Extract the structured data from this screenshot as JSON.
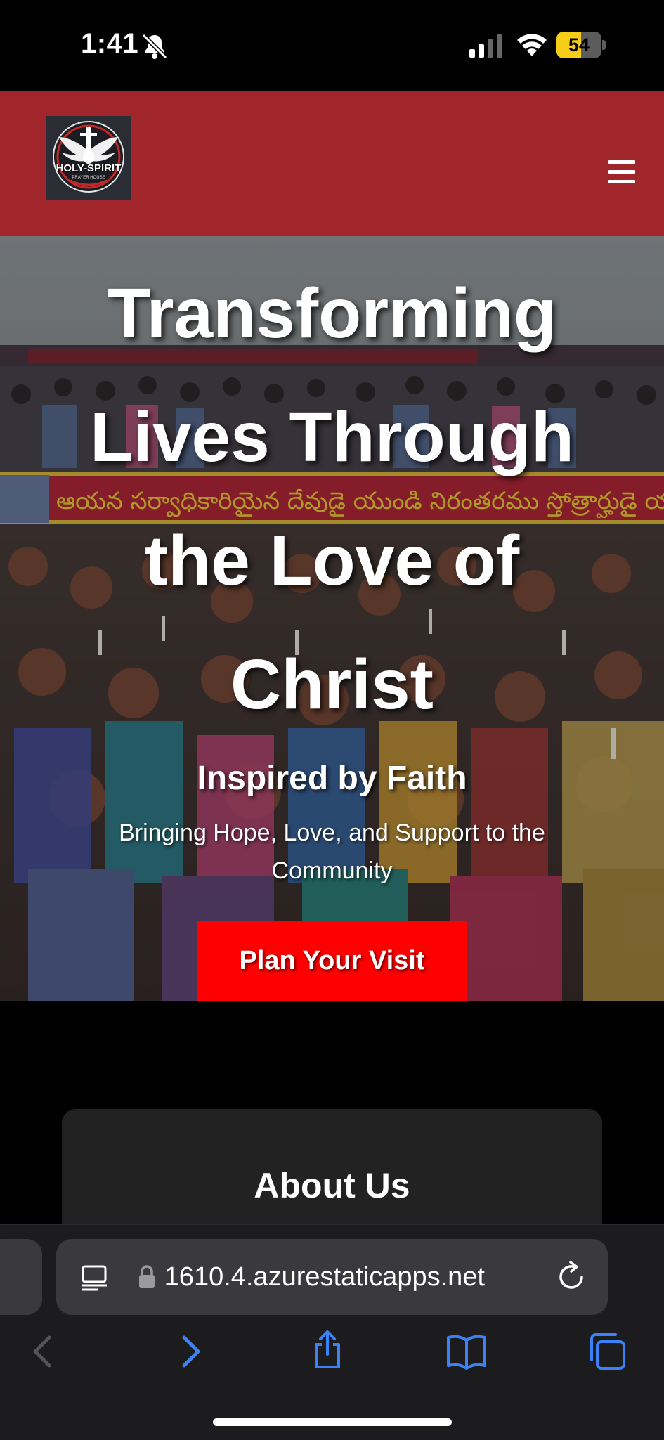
{
  "status_bar": {
    "time": "1:41",
    "battery": "54",
    "battery_level": 0.54,
    "icons": [
      "bell-slash-icon",
      "cellular-signal-icon",
      "wifi-icon",
      "battery-icon"
    ]
  },
  "header": {
    "logo_title": "HOLY-SPIRIT",
    "logo_subtitle": "PRAYER HOUSE",
    "menu_icon": "hamburger-menu-icon",
    "background_color": "#a1262b"
  },
  "hero": {
    "title": "Transforming Lives Through the Love of Christ",
    "subtitle": "Inspired by Faith",
    "text": "Bringing Hope, Love, and Support to the Community",
    "cta_label": "Plan Your Visit",
    "cta_color": "#fe0000",
    "banner_text": "ఆయన సర్వాధికారియైన దేవుడై యుండి నిరంతరము స్తోత్రార్హుడై యున్నాడు."
  },
  "about": {
    "title": "About Us"
  },
  "browser": {
    "url": "1610.4.azurestaticapps.net",
    "icons": [
      "reader-icon",
      "lock-icon",
      "reload-icon",
      "back-icon",
      "forward-icon",
      "share-icon",
      "bookmarks-icon",
      "tabs-icon"
    ],
    "accent_color": "#3b82f6"
  }
}
